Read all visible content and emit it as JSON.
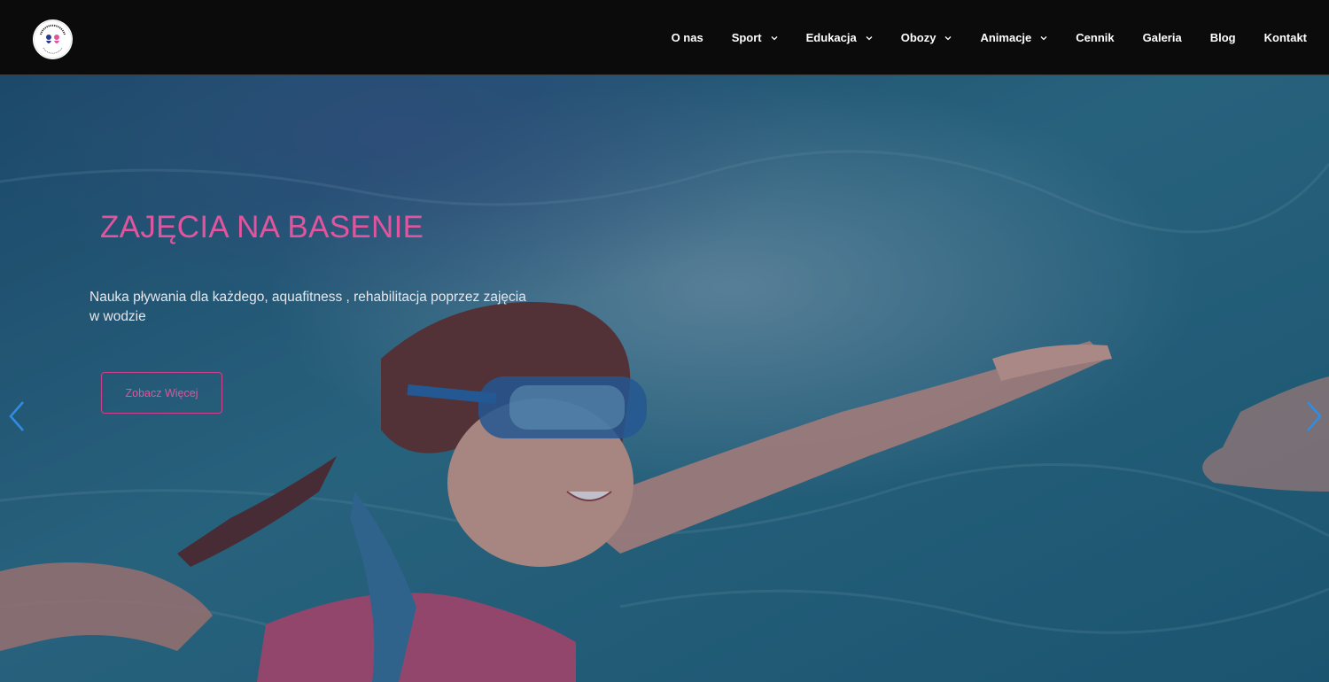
{
  "header": {
    "logo_icon": "champion-academy-logo",
    "nav": [
      {
        "label": "O nas",
        "has_dropdown": false
      },
      {
        "label": "Sport",
        "has_dropdown": true
      },
      {
        "label": "Edukacja",
        "has_dropdown": true
      },
      {
        "label": "Obozy",
        "has_dropdown": true
      },
      {
        "label": "Animacje",
        "has_dropdown": true
      },
      {
        "label": "Cennik",
        "has_dropdown": false
      },
      {
        "label": "Galeria",
        "has_dropdown": false
      },
      {
        "label": "Blog",
        "has_dropdown": false
      },
      {
        "label": "Kontakt",
        "has_dropdown": false
      }
    ]
  },
  "hero": {
    "title": "ZAJĘCIA NA BASENIE",
    "description": "Nauka pływania dla każdego, aquafitness , rehabilitacja poprzez zajęcia w wodzie",
    "button_label": "Zobacz Więcej",
    "prev_icon": "chevron-left-icon",
    "next_icon": "chevron-right-icon"
  },
  "colors": {
    "header_bg": "#0b0b0b",
    "accent_pink": "#e0559d",
    "arrow_blue": "#2f8de4",
    "water": "#2b6f86"
  }
}
